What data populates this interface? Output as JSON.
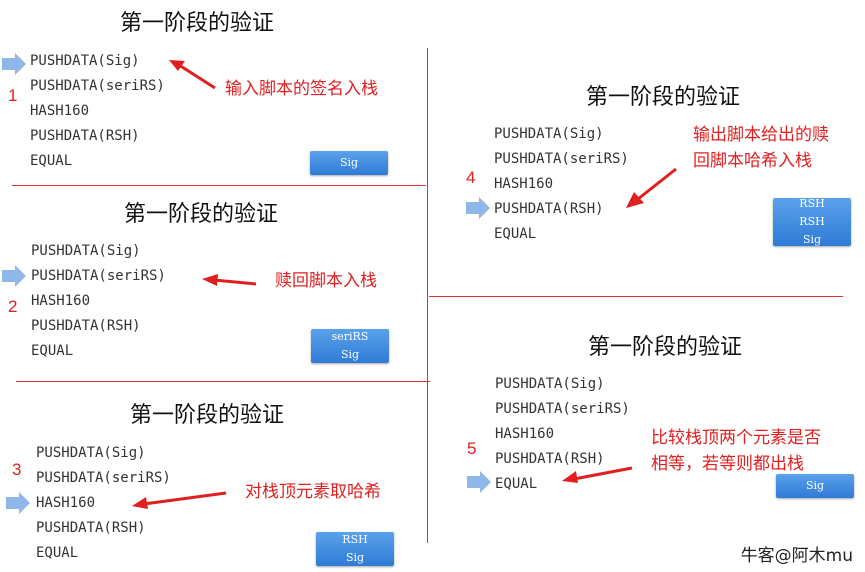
{
  "panels": [
    {
      "title": "第一阶段的验证",
      "step": "1",
      "code": [
        "PUSHDATA(Sig)",
        "PUSHDATA(seriRS)",
        "HASH160",
        "PUSHDATA(RSH)",
        "EQUAL"
      ],
      "note": [
        "输入脚本的签名入栈"
      ],
      "stack": [
        "Sig"
      ]
    },
    {
      "title": "第一阶段的验证",
      "step": "2",
      "code": [
        "PUSHDATA(Sig)",
        "PUSHDATA(seriRS)",
        "HASH160",
        "PUSHDATA(RSH)",
        "EQUAL"
      ],
      "note": [
        "赎回脚本入栈"
      ],
      "stack": [
        "seriRS",
        "Sig"
      ]
    },
    {
      "title": "第一阶段的验证",
      "step": "3",
      "code": [
        "PUSHDATA(Sig)",
        "PUSHDATA(seriRS)",
        "HASH160",
        "PUSHDATA(RSH)",
        "EQUAL"
      ],
      "note": [
        "对栈顶元素取哈希"
      ],
      "stack": [
        "RSH",
        "Sig"
      ]
    },
    {
      "title": "第一阶段的验证",
      "step": "4",
      "code": [
        "PUSHDATA(Sig)",
        "PUSHDATA(seriRS)",
        "HASH160",
        "PUSHDATA(RSH)",
        "EQUAL"
      ],
      "note": [
        "输出脚本给出的赎",
        "回脚本哈希入栈"
      ],
      "stack": [
        "RSH",
        "RSH",
        "Sig"
      ]
    },
    {
      "title": "第一阶段的验证",
      "step": "5",
      "code": [
        "PUSHDATA(Sig)",
        "PUSHDATA(seriRS)",
        "HASH160",
        "PUSHDATA(RSH)",
        "EQUAL"
      ],
      "note": [
        "比较栈顶两个元素是否",
        "相等，若等则都出栈"
      ],
      "stack": [
        "Sig"
      ]
    }
  ],
  "watermark": "牛客@阿木mu",
  "colors": {
    "accent": "#e02020",
    "stack_blue": "#3a86dc",
    "pointer": "#8fb8e8"
  }
}
